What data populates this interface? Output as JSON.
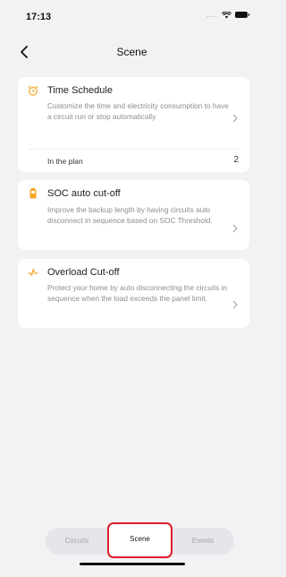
{
  "status_bar": {
    "time": "17:13",
    "signal": "....",
    "wifi_icon": "wifi-icon",
    "battery_icon": "battery-icon"
  },
  "header": {
    "title": "Scene",
    "back_icon": "chevron-left-icon"
  },
  "cards": [
    {
      "title": "Time Schedule",
      "description": "Customize the time and electricity consumption to have a circuit run or stop automatically.",
      "icon": "alarm-clock-icon",
      "icon_color": "#f5a623",
      "footer_label": "In the plan",
      "footer_value": "2"
    },
    {
      "title": "SOC auto cut-off",
      "description": "Improve the backup length by having circuits auto disconnect in sequence based on SOC Threshold.",
      "icon": "battery-level-icon",
      "icon_color": "#f5a623"
    },
    {
      "title": "Overload Cut-off",
      "description": "Protect your home by auto disconnecting the circuits in sequence when the load exceeds the panel limit.",
      "icon": "pulse-icon",
      "icon_color": "#f5a623"
    }
  ],
  "tabs": [
    {
      "label": "Circuits"
    },
    {
      "label": "Scene",
      "active": true
    },
    {
      "label": "Events"
    }
  ],
  "colors": {
    "accent": "#f5a623",
    "highlight": "#e01c2c",
    "background": "#f2f2f4"
  }
}
